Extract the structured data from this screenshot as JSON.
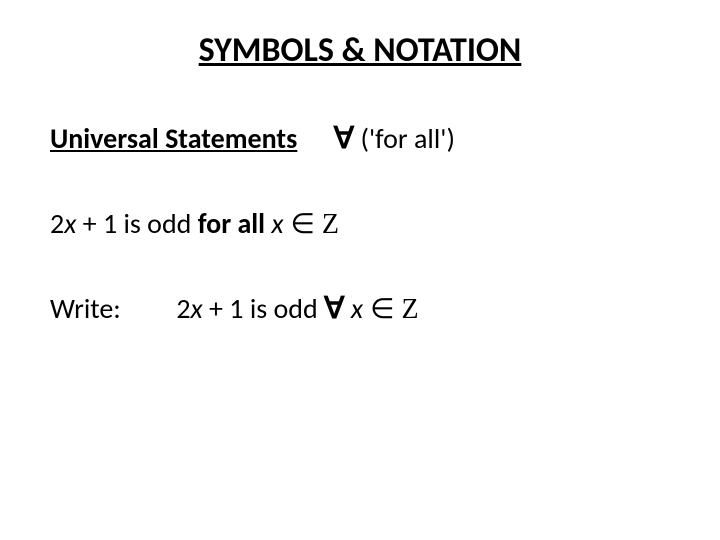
{
  "title": "SYMBOLS & NOTATION",
  "subtitle": {
    "text": "Universal Statements",
    "symbol": "∀",
    "label": "('for all')"
  },
  "statement": {
    "pre": "2",
    "var1": "x",
    "mid": " + 1 is odd ",
    "bold": "for all ",
    "var2": "x",
    "element": " ∈ ",
    "set": "Z"
  },
  "write": {
    "label": "Write:",
    "pre": "2",
    "var1": "x",
    "mid": " + 1 is odd ",
    "forall": "∀",
    "space": " ",
    "var2": "x",
    "element": " ∈ ",
    "set": "Z"
  }
}
